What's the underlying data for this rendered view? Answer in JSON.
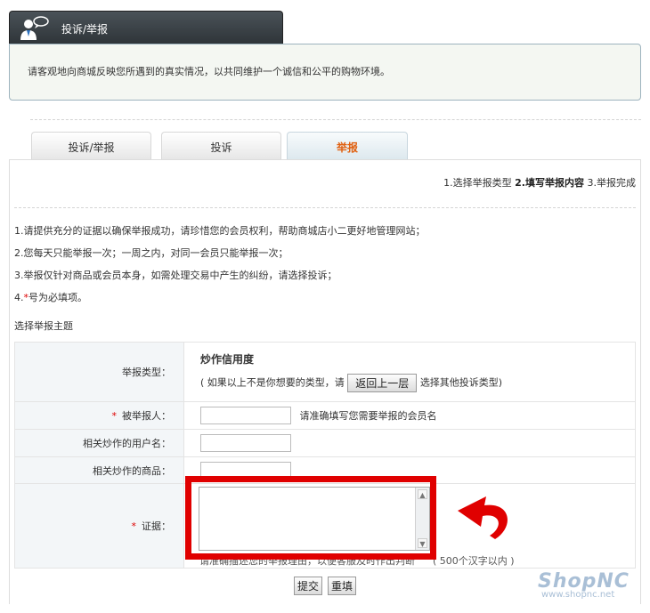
{
  "header": {
    "title": "投诉/举报",
    "icon": "user-speech-icon"
  },
  "info": {
    "text": "请客观地向商城反映您所遇到的真实情况，以共同维护一个诚信和公平的购物环境。"
  },
  "tabs": [
    {
      "label": "投诉/举报",
      "active": false
    },
    {
      "label": "投诉",
      "active": false
    },
    {
      "label": "举报",
      "active": true
    }
  ],
  "steps": {
    "step1": "1.选择举报类型",
    "step2": "2.填写举报内容",
    "step3": "3.举报完成"
  },
  "rules": [
    "1.请提供充分的证据以确保举报成功，请珍惜您的会员权利，帮助商城店小二更好地管理网站；",
    "2.您每天只能举报一次；一周之内，对同一会员只能举报一次；",
    "3.举报仅针对商品或会员本身，如需处理交易中产生的纠纷，请选择投诉；",
    "4."
  ],
  "rule4": {
    "star": "*",
    "text": "号为必填项。"
  },
  "section_title": "选择举报主题",
  "form": {
    "type": {
      "label": "举报类型：",
      "name": "炒作信用度",
      "hint_prefix": "( 如果以上不是你想要的类型，请",
      "back_button": "返回上一层",
      "hint_suffix": "选择其他投诉类型)"
    },
    "target": {
      "required": "*",
      "label": "被举报人：",
      "value": "",
      "hint": "请准确填写您需要举报的会员名"
    },
    "user": {
      "label": "相关炒作的用户名：",
      "value": ""
    },
    "goods": {
      "label": "相关炒作的商品：",
      "value": ""
    },
    "evidence": {
      "required": "*",
      "label": "证据：",
      "value": "",
      "hint": "请准确描述您的举报理由，以便客服及时作出判断",
      "limit": "( 500个汉字以内 )"
    }
  },
  "buttons": {
    "submit": "提交",
    "reset": "重填"
  },
  "logo": {
    "brand": "ShopNC",
    "url": "www.shopnc.net"
  },
  "colors": {
    "highlight": "#e00000",
    "active_tab_text": "#e06010",
    "required": "#dd0000"
  }
}
